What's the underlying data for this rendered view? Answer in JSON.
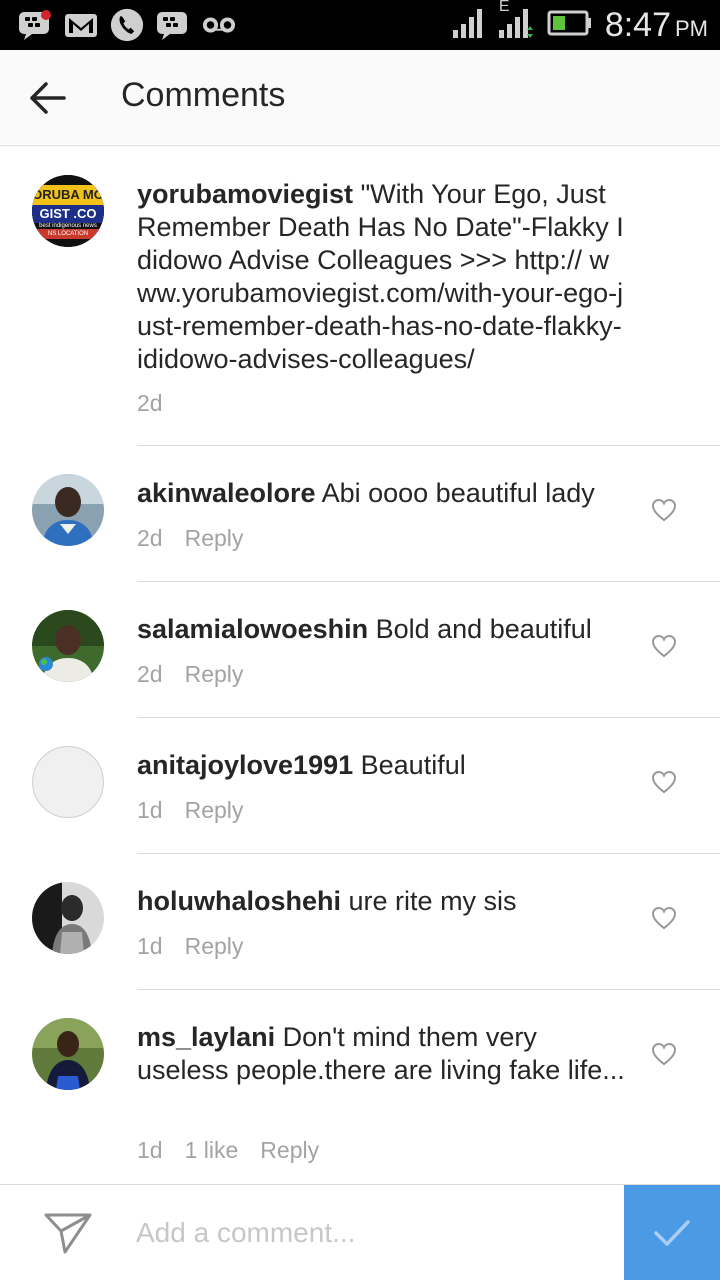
{
  "status_bar": {
    "time": "8:47",
    "ampm": "PM",
    "network": "E"
  },
  "header": {
    "title": "Comments"
  },
  "comments": [
    {
      "username": "yorubamoviegist",
      "text": "\"With Your Ego, Just Remember Death Has No Date\"-Flakky Ididowo Advise Colleagues >>> http:// www.yorubamoviegist.com/with-your-ego-just-remember-death-has-no-date-flakky-ididowo-advises-colleagues/",
      "age": "2d",
      "avatar_text_1": "ORUBA MO",
      "avatar_text_2": "GIST .CO",
      "avatar_text_3": "best indigenous news",
      "avatar_text_4": "NS LOCATION"
    },
    {
      "username": "akinwaleolore",
      "text": "Abi oooo beautiful lady",
      "age": "2d",
      "reply": "Reply"
    },
    {
      "username": "salamialowoeshin",
      "text": "Bold and beautiful",
      "age": "2d",
      "reply": "Reply"
    },
    {
      "username": "anitajoylove1991",
      "text": "Beautiful",
      "age": "1d",
      "reply": "Reply"
    },
    {
      "username": "holuwhaloshehi",
      "text": "ure rite my sis",
      "age": "1d",
      "reply": "Reply"
    },
    {
      "username": "ms_laylani",
      "text": "Don't mind them very useless people.there are living fake life...",
      "age": "1d",
      "likes": "1 like",
      "reply": "Reply"
    }
  ],
  "composer": {
    "placeholder": "Add a comment..."
  },
  "colors": {
    "accent": "#4a9ae6",
    "secondary_text": "#a3a3a3",
    "divider": "#dbdbdb"
  }
}
